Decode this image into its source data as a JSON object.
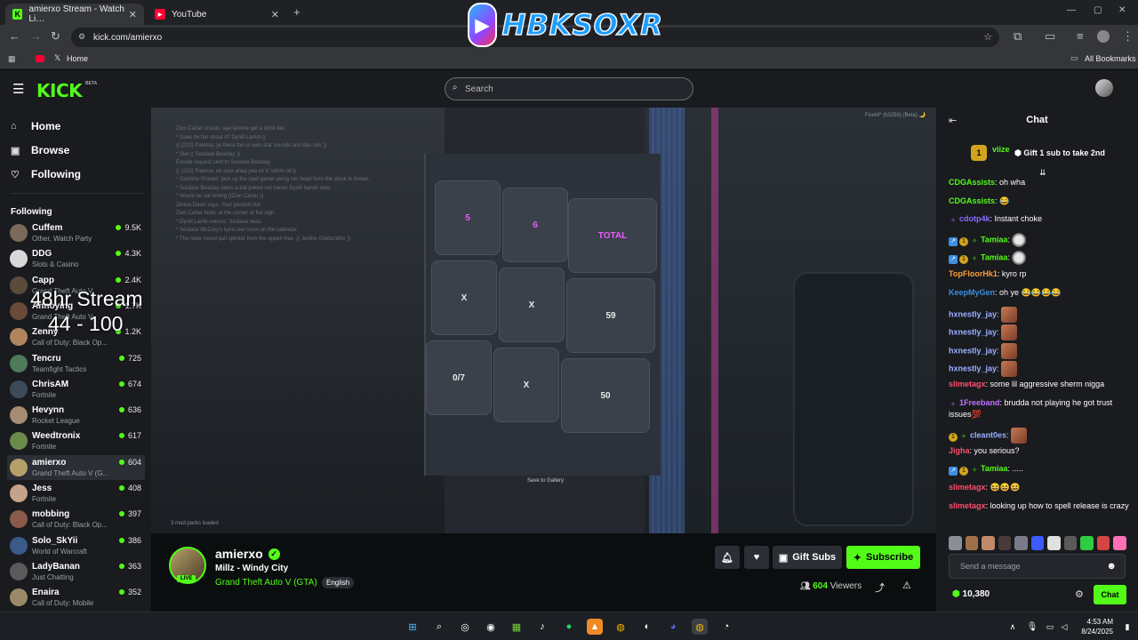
{
  "browser": {
    "tabs": [
      {
        "title": "amierxo Stream - Watch Li…",
        "favicon": "K",
        "active": true
      },
      {
        "title": "YouTube",
        "favicon": "▶",
        "active": false
      }
    ],
    "url": "kick.com/amierxo",
    "bookmarks": [
      "Home"
    ],
    "all_bookmarks": "All Bookmarks"
  },
  "overlay_logo": {
    "text": "HBKSOXR"
  },
  "site": {
    "logo": "KICK",
    "beta": "BETA",
    "search_placeholder": "Search"
  },
  "nav": {
    "home": "Home",
    "browse": "Browse",
    "following": "Following",
    "section_title": "Following"
  },
  "following_list": [
    {
      "name": "Cuffem",
      "game": "Other, Watch Party",
      "viewers": "9.5K"
    },
    {
      "name": "DDG",
      "game": "Slots & Casino",
      "viewers": "4.3K"
    },
    {
      "name": "Capp",
      "game": "Grand Theft Auto V",
      "viewers": "2.4K"
    },
    {
      "name": "Annoying",
      "game": "Grand Theft Auto V",
      "viewers": "1.7K"
    },
    {
      "name": "Zenny",
      "game": "Call of Duty: Black Op...",
      "viewers": "1.2K"
    },
    {
      "name": "Tencru",
      "game": "Teamfight Tactics",
      "viewers": "725"
    },
    {
      "name": "ChrisAM",
      "game": "Fortnite",
      "viewers": "674"
    },
    {
      "name": "Hevynn",
      "game": "Rocket League",
      "viewers": "636"
    },
    {
      "name": "Weedtronix",
      "game": "Fortnite",
      "viewers": "617"
    },
    {
      "name": "amierxo",
      "game": "Grand Theft Auto V (G...",
      "viewers": "604",
      "selected": true
    },
    {
      "name": "Jess",
      "game": "Fortnite",
      "viewers": "408"
    },
    {
      "name": "mobbing",
      "game": "Call of Duty: Black Op...",
      "viewers": "397"
    },
    {
      "name": "Solo_SkYii",
      "game": "World of Warcraft",
      "viewers": "386"
    },
    {
      "name": "LadyBanan",
      "game": "Just Chatting",
      "viewers": "363"
    },
    {
      "name": "Enaira",
      "game": "Call of Duty: Mobile",
      "viewers": "352"
    }
  ],
  "overlay": {
    "line1": "48hr Stream",
    "line2": "44 - 100"
  },
  "video": {
    "fivem": "FiveM* (b3258) (Beta) 🌙",
    "gallery": "Save to Gallery",
    "mod_packs": "3 mod packs loaded",
    "chatlog": [
      "Zion Carter shouts: aye lemme get a drink fan.",
      "* Does he fan shout it? Dynill Lamot ((",
      "(( (222) Paloma: ye there fan ur won star sounds and dao sim ))",
      "* Ske (( Soulase Beaslay ))",
      "  Emolle request sent to Soulase Beaslay.",
      "(( (222) Paloma: ok sure ahaa yea ex tt 'sahrn ok'))",
      "* Oskhme Proned: pick up the stad gamel along ner head form the stock to brown.",
      "* Soulase Beaslay takes a bat poked out hands Dynill hands now.",
      "* Would be sai foritng ((Zion Carter ))",
      "Zinera Davis says: Your pockets full.",
      "  Zion Carter looks at the corner of fire sign.",
      "* Dynill Lamb relesss: Soulase neck.",
      "* Soulase McCrey's turns bar room on the calendar.",
      "* The mole round pull splinter from the uppen free. (( Jesthe Goldsmiths ))"
    ],
    "tiles": [
      "5",
      "6",
      "TOTAL",
      "X",
      "X",
      "59",
      "0/7",
      "X",
      "50"
    ]
  },
  "stream": {
    "name": "amierxo",
    "title": "Millz - Windy City",
    "category": "Grand Theft Auto V (GTA)",
    "language": "English",
    "live": "LIVE",
    "viewers": "604",
    "viewers_label": "Viewers",
    "gift_subs": "Gift Subs",
    "subscribe": "Subscribe"
  },
  "chat": {
    "title": "Chat",
    "pinned_user": "viize",
    "pinned_count": "1",
    "pinned_text": "Gift 1 sub to take 2nd",
    "messages": [
      {
        "user": "CDGAssists",
        "text": "oh wha",
        "color": "#53fc18"
      },
      {
        "user": "CDGAssists",
        "text": "😂",
        "color": "#53fc18"
      },
      {
        "user": "cdotp4k",
        "text": "Instant choke",
        "color": "#8a6bff"
      },
      {
        "user": "Tamiaa",
        "text": "",
        "color": "#53fc18"
      },
      {
        "user": "Tamiaa",
        "text": "",
        "color": "#53fc18"
      },
      {
        "user": "TopFloorHk1",
        "text": "kyro rp",
        "color": "#ff9d35"
      },
      {
        "user": "KeepMyGen",
        "text": "oh ye 😂😂😂😂",
        "color": "#3d8fe0"
      },
      {
        "user": "hxnestly_jay",
        "text": "",
        "color": "#9ab0ff"
      },
      {
        "user": "hxnestly_jay",
        "text": "",
        "color": "#9ab0ff"
      },
      {
        "user": "hxnestly_jay",
        "text": "",
        "color": "#9ab0ff"
      },
      {
        "user": "hxnestly_jay",
        "text": "",
        "color": "#9ab0ff"
      },
      {
        "user": "slimetagx",
        "text": "some lil aggressive sherm nigga",
        "color": "#ff4d6d"
      },
      {
        "user": "1Freeband",
        "text": "brudda not playing he got trust issues💯",
        "color": "#c173ff"
      },
      {
        "user": "cleant0es",
        "text": "",
        "color": "#9ab0ff"
      },
      {
        "user": "Jigha",
        "text": "you serious?",
        "color": "#ff4d6d"
      },
      {
        "user": "Tamiaa",
        "text": ".....",
        "color": "#53fc18"
      },
      {
        "user": "slimetagx",
        "text": "😆😆😆",
        "color": "#ff4d6d"
      },
      {
        "user": "slimetagx",
        "text": "looking up how to spell release is crazy",
        "color": "#ff4d6d"
      }
    ],
    "input_placeholder": "Send a message",
    "points": "10,380",
    "send": "Chat"
  },
  "taskbar": {
    "time": "4:53 AM",
    "date": "8/24/2025"
  },
  "colors": {
    "kick_green": "#53fc18",
    "bg": "#0b0e0f",
    "panel": "#191b1f"
  }
}
